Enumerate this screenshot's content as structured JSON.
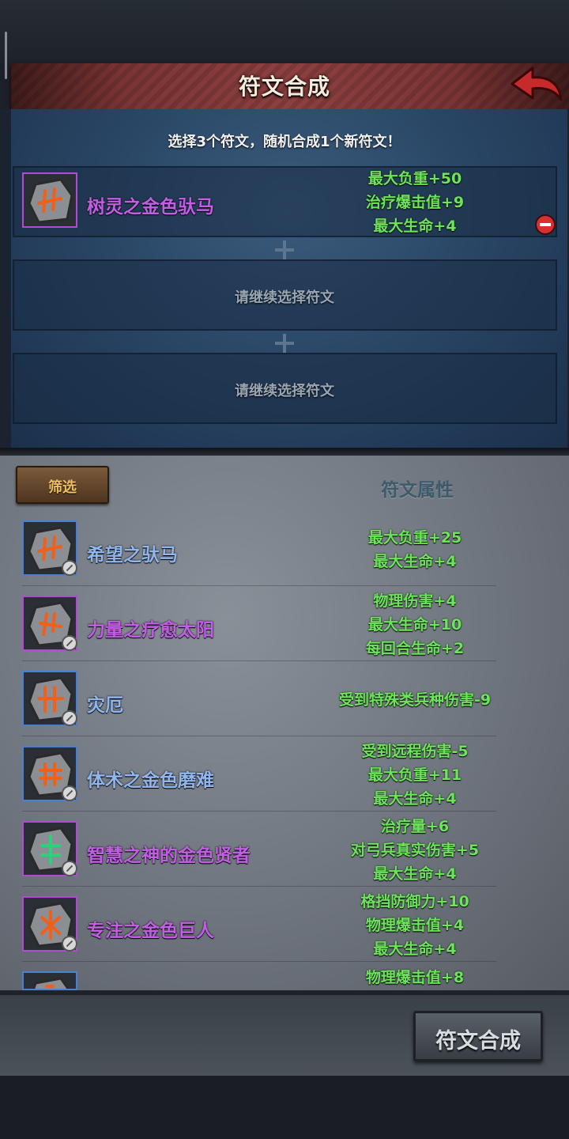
{
  "header": {
    "title": "符文合成"
  },
  "selection": {
    "instruction": "选择3个符文，随机合成1个新符文！",
    "selected": {
      "name": "树灵之金色驮马",
      "stats": [
        "最大负重+50",
        "治疗爆击值+9",
        "最大生命+4"
      ],
      "rarity_color": "#c25ee6"
    },
    "empty_hint_1": "请继续选择符文",
    "empty_hint_2": "请继续选择符文"
  },
  "list": {
    "filter_label": "筛选",
    "attr_header": "符文属性",
    "items": [
      {
        "name": "希望之驮马",
        "stats": [
          "最大负重+25",
          "最大生命+4"
        ]
      },
      {
        "name": "力量之疗愈太阳",
        "stats": [
          "物理伤害+4",
          "最大生命+10",
          "每回合生命+2"
        ]
      },
      {
        "name": "灾厄",
        "stats": [
          "受到特殊类兵种伤害-9"
        ]
      },
      {
        "name": "体术之金色磨难",
        "stats": [
          "受到远程伤害-5",
          "最大负重+11",
          "最大生命+4"
        ]
      },
      {
        "name": "智慧之神的金色贤者",
        "stats": [
          "治疗量+6",
          "对弓兵真实伤害+5",
          "最大生命+4"
        ]
      },
      {
        "name": "专注之金色巨人",
        "stats": [
          "格挡防御力+10",
          "物理爆击值+4",
          "最大生命+4"
        ]
      },
      {
        "name": "",
        "stats": [
          "物理爆击值+8"
        ]
      }
    ]
  },
  "footer": {
    "compose_label": "符文合成"
  },
  "colors": {
    "stat_green": "#6ee35c",
    "purple": "#c25ee6",
    "blue": "#8fb6ee",
    "title_bar": "#8e4040"
  }
}
